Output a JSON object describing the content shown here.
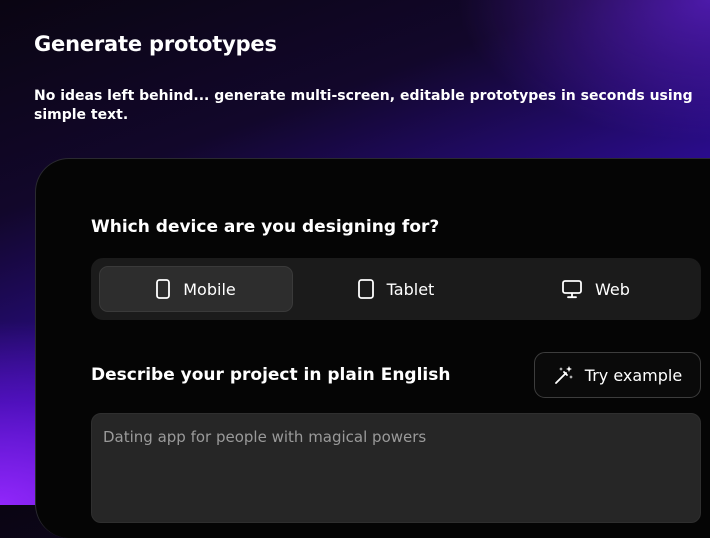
{
  "hero": {
    "title": "Generate prototypes",
    "subtitle": "No ideas left behind... generate multi-screen, editable prototypes in seconds using simple text."
  },
  "device_selector": {
    "question": "Which device are you designing for?",
    "selected": "Mobile",
    "options": [
      {
        "label": "Mobile",
        "icon": "mobile-icon"
      },
      {
        "label": "Tablet",
        "icon": "tablet-icon"
      },
      {
        "label": "Web",
        "icon": "monitor-icon"
      }
    ]
  },
  "project": {
    "label": "Describe your project in plain English",
    "try_example_label": "Try example",
    "try_example_icon": "magic-wand-icon",
    "placeholder": "Dating app for people with magical powers",
    "value": ""
  },
  "colors": {
    "panel_background": "#050505",
    "selected_option_background": "#2d2d2d",
    "input_background": "#262626",
    "accent_purple": "#4b10d6"
  }
}
